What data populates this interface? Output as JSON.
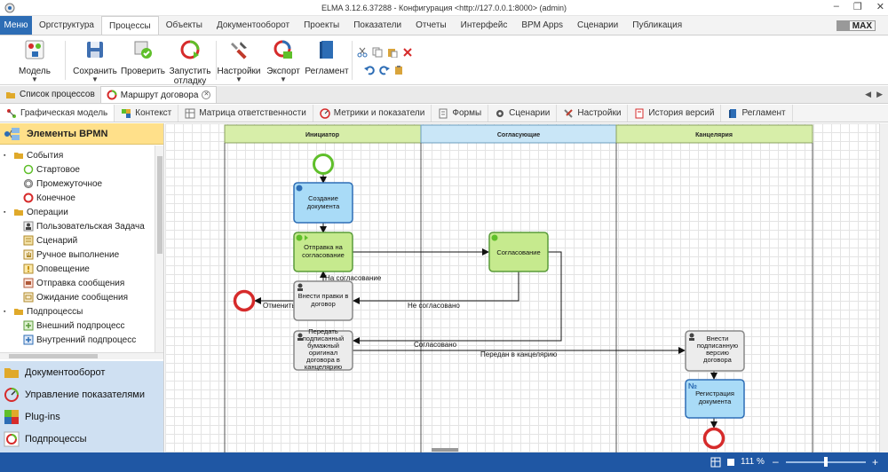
{
  "window": {
    "title": "ELMA 3.12.6.37288 - Конфигурация <http://127.0.0.1:8000> (admin)"
  },
  "menubar": {
    "menu_label": "Меню",
    "tabs": [
      "Оргструктура",
      "Процессы",
      "Объекты",
      "Документооборот",
      "Проекты",
      "Показатели",
      "Отчеты",
      "Интерфейс",
      "BPM Apps",
      "Сценарии",
      "Публикация"
    ],
    "active_tab": "Процессы",
    "max_label": "MAX"
  },
  "ribbon": {
    "model": "Модель",
    "save": "Сохранить",
    "check": "Проверить",
    "run_debug_1": "Запустить",
    "run_debug_2": "отладку",
    "settings": "Настройки",
    "export": "Экспорт",
    "reglament": "Регламент"
  },
  "doc_tabs": {
    "process_list": "Список процессов",
    "route": "Маршрут договора"
  },
  "sub_tabs": [
    "Графическая модель",
    "Контекст",
    "Матрица ответственности",
    "Метрики и показатели",
    "Формы",
    "Сценарии",
    "Настройки",
    "История версий",
    "Регламент"
  ],
  "left_panel": {
    "header": "Элементы BPMN",
    "tree": {
      "events": "События",
      "start": "Стартовое",
      "intermediate": "Промежуточное",
      "end": "Конечное",
      "operations": "Операции",
      "user_task": "Пользовательская Задача",
      "scenario": "Сценарий",
      "manual": "Ручное выполнение",
      "notify": "Оповещение",
      "send_msg": "Отправка сообщения",
      "wait_msg": "Ожидание сообщения",
      "subprocesses": "Подпроцессы",
      "ext_sub": "Внешний подпроцесс",
      "int_sub": "Внутренний подпроцесс"
    },
    "sections": [
      "Документооборот",
      "Управление показателями",
      "Plug-ins",
      "Подпроцессы"
    ]
  },
  "diagram": {
    "lanes": [
      "Инициатор",
      "Согласующие",
      "Канцелярия"
    ],
    "nodes": {
      "create_1": "Создание",
      "create_2": "документа",
      "send_1": "Отправка на",
      "send_2": "согласование",
      "approve": "Согласование",
      "fix_1": "Внести правки в",
      "fix_2": "договор",
      "handover_1": "Передать",
      "handover_2": "подписанный",
      "handover_3": "бумажный",
      "handover_4": "оригинал",
      "handover_5": "договора в",
      "handover_6": "канцелярию",
      "signed_1": "Внести",
      "signed_2": "подписанную",
      "signed_3": "версию",
      "signed_4": "договора",
      "reg_1": "Регистрация",
      "reg_2": "документа"
    },
    "flows": {
      "to_approval": "На согласование",
      "cancel": "Отменить",
      "not_approved": "Не согласовано",
      "approved": "Согласовано",
      "to_office": "Передан в канцелярию"
    },
    "reg_marker": "№"
  },
  "statusbar": {
    "zoom": "111 %"
  },
  "colors": {
    "accent": "#2d6db5",
    "start_event": "#5fbf2a",
    "end_event": "#d62b2b",
    "lane_green": "#d7eea9",
    "lane_blue": "#c9e6f7",
    "task_blue": "#a9dbf7",
    "task_green": "#c6ea8e",
    "task_gray": "#ececec"
  }
}
